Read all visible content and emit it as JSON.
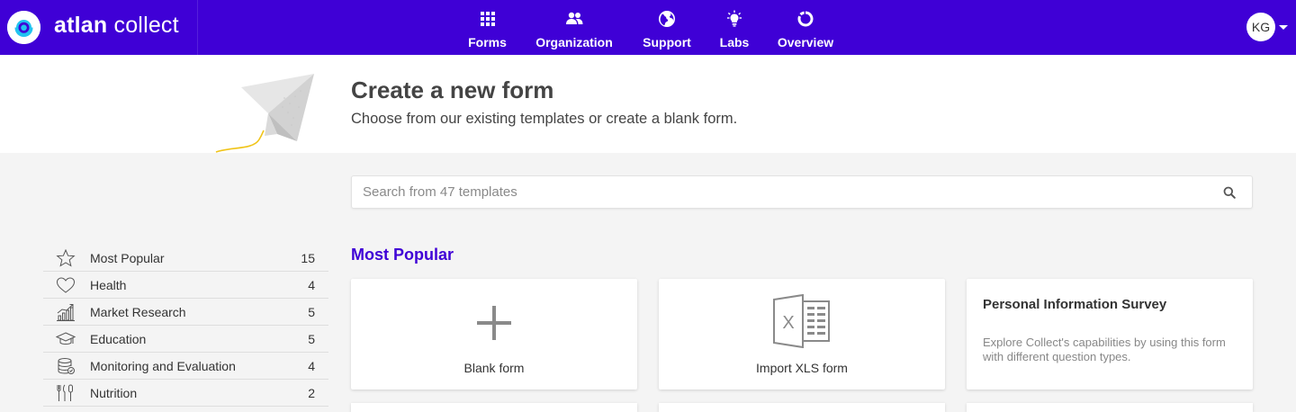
{
  "brand": {
    "name_bold": "atlan",
    "name_light": " collect"
  },
  "nav": {
    "items": [
      {
        "label": "Forms",
        "icon": "grid-icon"
      },
      {
        "label": "Organization",
        "icon": "people-icon"
      },
      {
        "label": "Support",
        "icon": "globe-icon"
      },
      {
        "label": "Labs",
        "icon": "lightbulb-icon"
      },
      {
        "label": "Overview",
        "icon": "ring-icon"
      }
    ]
  },
  "user": {
    "initials": "KG"
  },
  "hero": {
    "title": "Create a new form",
    "subtitle": "Choose from our existing templates or create a blank form."
  },
  "search": {
    "placeholder": "Search from 47 templates",
    "value": ""
  },
  "categories": [
    {
      "label": "Most Popular",
      "count": "15",
      "icon": "star-icon"
    },
    {
      "label": "Health",
      "count": "4",
      "icon": "heart-icon"
    },
    {
      "label": "Market Research",
      "count": "5",
      "icon": "chart-icon"
    },
    {
      "label": "Education",
      "count": "5",
      "icon": "graduation-cap-icon"
    },
    {
      "label": "Monitoring and Evaluation",
      "count": "4",
      "icon": "database-icon"
    },
    {
      "label": "Nutrition",
      "count": "2",
      "icon": "cutlery-icon"
    }
  ],
  "section": {
    "title": "Most Popular"
  },
  "cards": [
    {
      "label": "Blank form",
      "icon": "plus-icon"
    },
    {
      "label": "Import XLS form",
      "icon": "excel-icon"
    },
    {
      "title": "Personal Information Survey",
      "description": "Explore Collect's capabilities by using this form with different question types."
    }
  ],
  "colors": {
    "brand": "#3f00d6",
    "accent": "#22c3f0",
    "plane_trail": "#f0c419"
  }
}
